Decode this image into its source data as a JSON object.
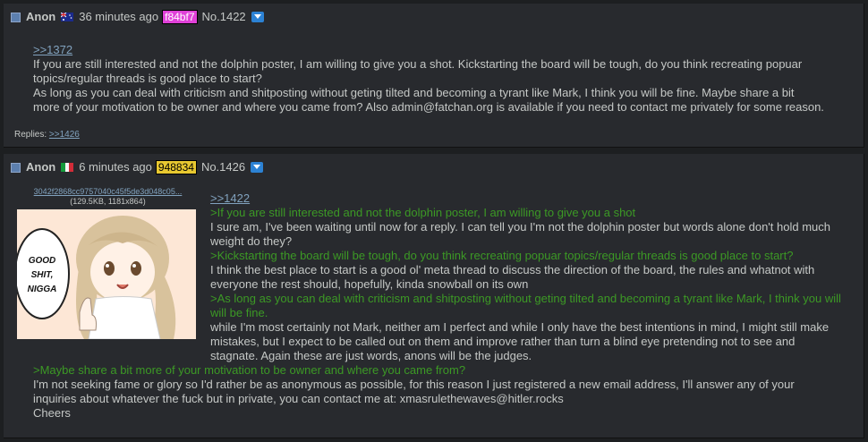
{
  "posts": [
    {
      "name": "Anon",
      "flag": "australia-flag-icon",
      "time": "36 minutes ago",
      "id": "f84bf7",
      "id_color": "#e040d8",
      "id_text_color": "#ffffff",
      "number": "No.1422",
      "body": {
        "quote": ">>1372",
        "lines": [
          "If you are still interested and not the dolphin poster, I am willing to give you a shot. Kickstarting the board will be tough, do you think recreating popuar",
          "topics/regular threads is good place to start?",
          "As long as you can deal with criticism and shitposting without geting tilted and becoming a tyrant like Mark, I think you will be fine. Maybe share a bit",
          "more of your motivation to be owner and where you came from? Also admin@fatchan.org is available if you need to contact me privately for some reason."
        ]
      },
      "replies_label": "Replies:",
      "replies": [
        ">>1426"
      ]
    },
    {
      "name": "Anon",
      "flag": "italy-flag-icon",
      "time": "6 minutes ago",
      "id": "948834",
      "id_color": "#e8c830",
      "id_text_color": "#000000",
      "number": "No.1426",
      "file": {
        "name": "3042f2868cc9757040c45f5de3d048c05...",
        "meta": "(129.5KB, 1181x864)",
        "speech": [
          "GOOD",
          "SHIT,",
          "NIGGA"
        ]
      },
      "body": {
        "quote": ">>1422",
        "lines": [
          {
            "green": true,
            "text": ">If you are still interested and not the dolphin poster, I am willing to give you a shot"
          },
          {
            "green": false,
            "text": "I sure am, I've been waiting until now for a reply. I can tell you I'm not the dolphin poster but words alone don't hold much"
          },
          {
            "green": false,
            "text": "weight do they?"
          },
          {
            "green": true,
            "text": ">Kickstarting the board will be tough, do you think recreating popuar topics/regular threads is good place to start?"
          },
          {
            "green": false,
            "text": "I think the best place to start is a good ol' meta thread to discuss the direction of the board, the rules and whatnot with"
          },
          {
            "green": false,
            "text": "everyone the rest should, hopefully, kinda snowball on its own"
          },
          {
            "green": true,
            "text": ">As long as you can deal with criticism and shitposting without geting tilted and becoming a tyrant like Mark, I think you will"
          },
          {
            "green": true,
            "text": "will be fine."
          },
          {
            "green": false,
            "text": "while I'm most certainly not Mark, neither am I perfect and while I only have the best intentions in mind, I might still make"
          },
          {
            "green": false,
            "text": "mistakes, but I expect to be called out on them and improve rather than turn a blind eye pretending not to see and"
          },
          {
            "green": false,
            "text": "stagnate. Again these are just words, anons will be the judges."
          }
        ],
        "wide_lines": [
          {
            "green": true,
            "text": ">Maybe share a bit more of your motivation to be owner and where you came from?"
          },
          {
            "green": false,
            "text": "I'm not seeking fame or glory so I'd rather be as anonymous as possible, for this reason I just registered a new email address, I'll answer any of your"
          },
          {
            "green": false,
            "text": "inquiries about whatever the fuck but in private, you can contact me at: xmasrulethewaves@hitler.rocks"
          },
          {
            "green": false,
            "text": "Cheers"
          }
        ]
      }
    }
  ]
}
